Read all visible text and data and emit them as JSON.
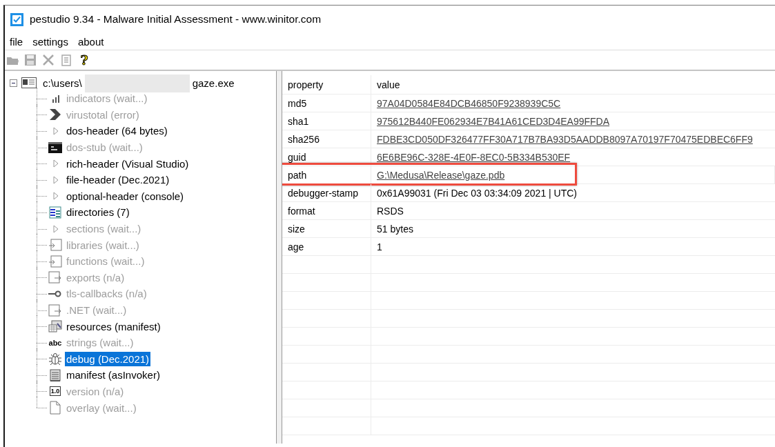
{
  "window": {
    "title": "pestudio 9.34 - Malware Initial Assessment - www.winitor.com"
  },
  "menu": [
    {
      "label": "file"
    },
    {
      "label": "settings"
    },
    {
      "label": "about"
    }
  ],
  "toolbar": [
    {
      "kind": "open",
      "disabled": true
    },
    {
      "kind": "save",
      "disabled": true
    },
    {
      "kind": "cut",
      "disabled": true
    },
    {
      "kind": "clipboard",
      "disabled": true
    },
    {
      "kind": "help",
      "glyph": "?",
      "disabled": false
    }
  ],
  "tree": {
    "root": {
      "label_start": "c:\\users\\",
      "label_end": "gaze.exe",
      "expanded": true,
      "children": [
        {
          "kind": "bars",
          "label": "indicators (wait...)",
          "enabled": false,
          "selected": false
        },
        {
          "kind": "chevron",
          "label": "virustotal (error)",
          "enabled": false,
          "selected": false
        },
        {
          "kind": "triangle",
          "label": "dos-header (64 bytes)",
          "enabled": true,
          "selected": false
        },
        {
          "kind": "console",
          "label": "dos-stub (wait...)",
          "enabled": false,
          "selected": false
        },
        {
          "kind": "triangle",
          "label": "rich-header (Visual Studio)",
          "enabled": true,
          "selected": false
        },
        {
          "kind": "triangle",
          "label": "file-header (Dec.2021)",
          "enabled": true,
          "selected": false
        },
        {
          "kind": "triangle",
          "label": "optional-header (console)",
          "enabled": true,
          "selected": false
        },
        {
          "kind": "grid",
          "label": "directories (7)",
          "enabled": true,
          "selected": false
        },
        {
          "kind": "triangle",
          "label": "sections (wait...)",
          "enabled": false,
          "selected": false
        },
        {
          "kind": "import",
          "label": "libraries (wait...)",
          "enabled": false,
          "selected": false
        },
        {
          "kind": "import",
          "label": "functions (wait...)",
          "enabled": false,
          "selected": false
        },
        {
          "kind": "export",
          "label": "exports (n/a)",
          "enabled": false,
          "selected": false
        },
        {
          "kind": "key",
          "label": "tls-callbacks (n/a)",
          "enabled": false,
          "selected": false
        },
        {
          "kind": "export",
          "label": ".NET (wait...)",
          "enabled": false,
          "selected": false
        },
        {
          "kind": "resources",
          "label": "resources (manifest)",
          "enabled": true,
          "selected": false
        },
        {
          "kind": "glyph",
          "glyph": "abc",
          "label": "strings (wait...)",
          "enabled": false,
          "selected": false
        },
        {
          "kind": "bug",
          "label": "debug (Dec.2021)",
          "enabled": true,
          "selected": true
        },
        {
          "kind": "document",
          "label": "manifest (asInvoker)",
          "enabled": true,
          "selected": false
        },
        {
          "kind": "boxed-glyph",
          "glyph": "1.0",
          "label": "version (n/a)",
          "enabled": false,
          "selected": false
        },
        {
          "kind": "page",
          "label": "overlay (wait...)",
          "enabled": false,
          "selected": false
        }
      ]
    }
  },
  "table": {
    "columns": [
      "property",
      "value"
    ],
    "rows": [
      {
        "property": "md5",
        "value": "97A04D0584E84DCB46850F9238939C5C",
        "kind": "link",
        "highlighted": false
      },
      {
        "property": "sha1",
        "value": "975612B440FE062934E7B41A61CED3D4EA99FFDA",
        "kind": "link",
        "highlighted": false
      },
      {
        "property": "sha256",
        "value": "FDBE3CD050DF326477FF30A717B7BA93D5AADDB8097A70197F70475EDBEC6FF9",
        "kind": "link",
        "highlighted": false
      },
      {
        "property": "guid",
        "value": "6E6BE96C-328E-4E0F-8EC0-5B334B530EF",
        "kind": "link",
        "highlighted": false
      },
      {
        "property": "path",
        "value": "G:\\Medusa\\Release\\gaze.pdb",
        "kind": "link",
        "highlighted": true
      },
      {
        "property": "debugger-stamp",
        "value": "0x61A99031 (Fri Dec 03 03:34:09 2021 | UTC)",
        "kind": "text",
        "highlighted": false
      },
      {
        "property": "format",
        "value": "RSDS",
        "kind": "text",
        "highlighted": false
      },
      {
        "property": "size",
        "value": "51 bytes",
        "kind": "text",
        "highlighted": false
      },
      {
        "property": "age",
        "value": "1",
        "kind": "text",
        "highlighted": false
      }
    ]
  }
}
